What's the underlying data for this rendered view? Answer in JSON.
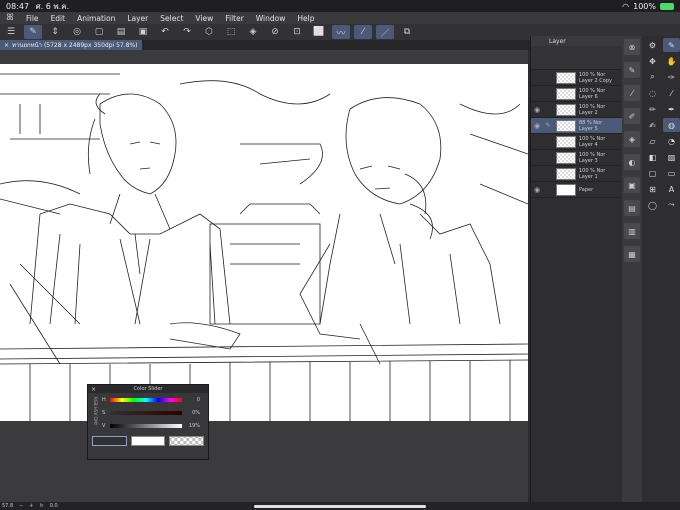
{
  "status": {
    "time": "08:47",
    "date": "ศ. 6 พ.ค.",
    "battery": "100%"
  },
  "menu": {
    "items": [
      "File",
      "Edit",
      "Animation",
      "Layer",
      "Select",
      "View",
      "Filter",
      "Window",
      "Help"
    ]
  },
  "tab": {
    "title": "ทานยกหน้า (5728 x 2489px 350dpi 57.8%)"
  },
  "layer_panel": {
    "title": "Layer",
    "layers": [
      {
        "opacity": "100 %",
        "mode": "Nor",
        "name": "Layer 2 Copy"
      },
      {
        "opacity": "100 %",
        "mode": "Nor",
        "name": "Layer 6"
      },
      {
        "opacity": "100 %",
        "mode": "Nor",
        "name": "Layer 2"
      },
      {
        "opacity": "88 %",
        "mode": "Nor",
        "name": "Layer 5"
      },
      {
        "opacity": "100 %",
        "mode": "Nor",
        "name": "Layer 4"
      },
      {
        "opacity": "100 %",
        "mode": "Nor",
        "name": "Layer 3"
      },
      {
        "opacity": "100 %",
        "mode": "Nor",
        "name": "Layer 1"
      },
      {
        "opacity": "",
        "mode": "",
        "name": "Paper"
      }
    ]
  },
  "color_slider": {
    "title": "Color Slider",
    "h_label": "H",
    "h_value": "0",
    "s_label": "S",
    "s_value": "0%",
    "v_label": "V",
    "v_value": "19%",
    "tabs_label": "RGB HSV CMY"
  },
  "bottom": {
    "zoom": "57.8",
    "rotation": "0.0"
  },
  "colors": {
    "accent": "#4a5a78",
    "main_color": "#303030",
    "sub_color": "#ffffff"
  }
}
